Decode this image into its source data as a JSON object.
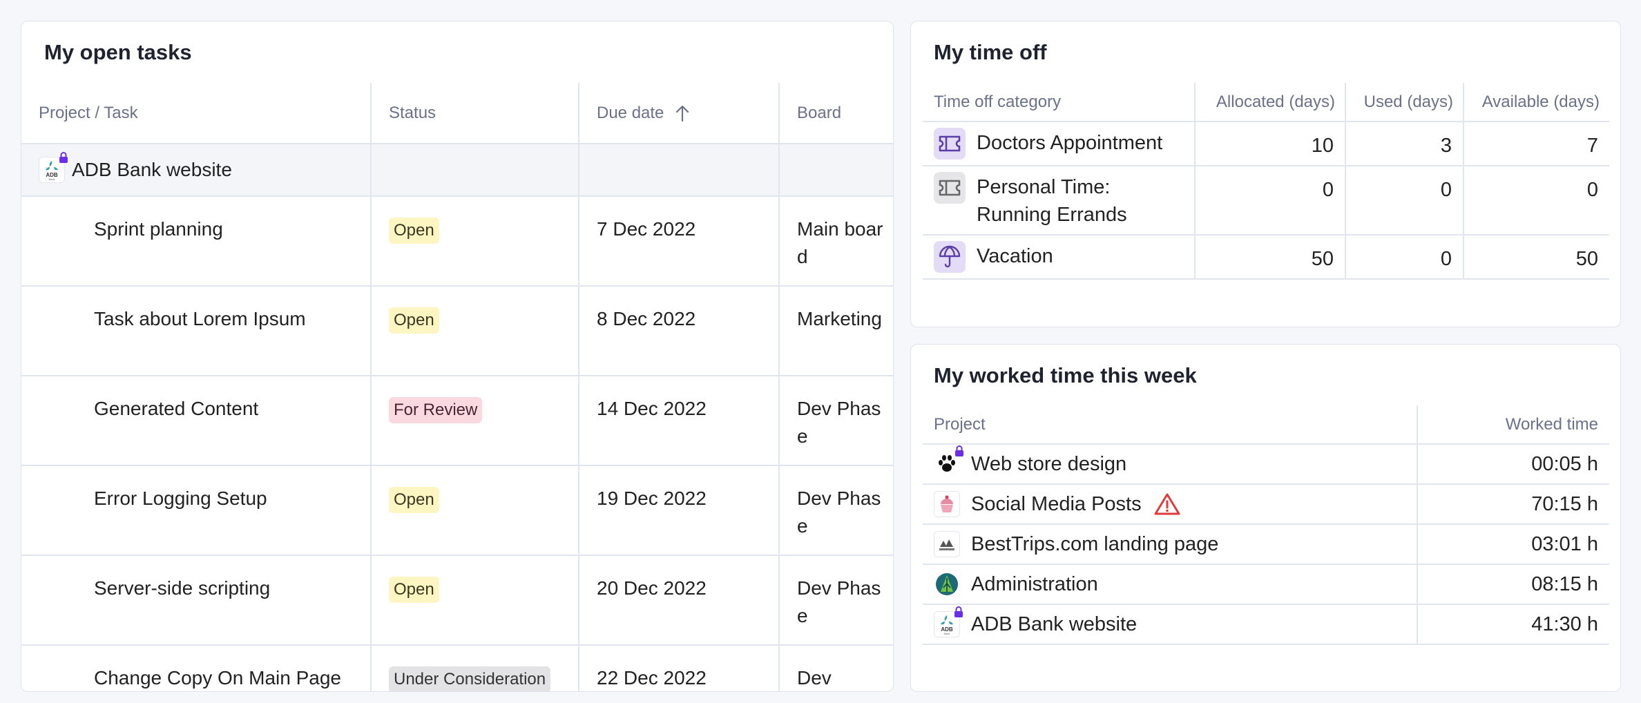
{
  "tasks": {
    "title": "My open tasks",
    "columns": {
      "project_task": "Project / Task",
      "status": "Status",
      "due_date": "Due date",
      "board": "Board"
    },
    "group": {
      "name": "ADB Bank website"
    },
    "rows": [
      {
        "name": "Sprint planning",
        "status": "Open",
        "due": "7 Dec 2022",
        "board": "Main board"
      },
      {
        "name": "Task about Lorem Ipsum",
        "status": "Open",
        "due": "8 Dec 2022",
        "board": "Marketing"
      },
      {
        "name": "Generated Content",
        "status": "For Review",
        "due": "14 Dec 2022",
        "board": "Dev Phase"
      },
      {
        "name": "Error Logging Setup",
        "status": "Open",
        "due": "19 Dec 2022",
        "board": "Dev Phase"
      },
      {
        "name": "Server-side scripting",
        "status": "Open",
        "due": "20 Dec 2022",
        "board": "Dev Phase"
      },
      {
        "name": "Change Copy On Main Page",
        "status": "Under Consideration",
        "due": "22 Dec 2022",
        "board": "Dev"
      }
    ]
  },
  "status_colors": {
    "Open": {
      "bg": "#fdf6c3",
      "fg": "#3b3620"
    },
    "For Review": {
      "bg": "#fbd9e1",
      "fg": "#4a2530"
    },
    "Under Consideration": {
      "bg": "#e3e3e5",
      "fg": "#333333"
    }
  },
  "time_off": {
    "title": "My time off",
    "columns": {
      "category": "Time off category",
      "allocated": "Allocated (days)",
      "used": "Used (days)",
      "available": "Available (days)"
    },
    "rows": [
      {
        "category": "Doctors Appointment",
        "icon": "ticket-icon",
        "icon_bg": "#e4dbf7",
        "icon_color": "#5b3ea8",
        "allocated": "10",
        "used": "3",
        "available": "7"
      },
      {
        "category": "Personal Time: Running Errands",
        "icon": "ticket-icon",
        "icon_bg": "#e6e6e8",
        "icon_color": "#666666",
        "allocated": "0",
        "used": "0",
        "available": "0"
      },
      {
        "category": "Vacation",
        "icon": "umbrella-icon",
        "icon_bg": "#e4dbf7",
        "icon_color": "#5b3ea8",
        "allocated": "50",
        "used": "0",
        "available": "50"
      }
    ]
  },
  "worked": {
    "title": "My worked time this week",
    "columns": {
      "project": "Project",
      "worked_time": "Worked time"
    },
    "rows": [
      {
        "project": "Web store design",
        "logo": "paw-logo",
        "locked": true,
        "warning": false,
        "time": "00:05 h"
      },
      {
        "project": "Social Media Posts",
        "logo": "cupcake-logo",
        "locked": false,
        "warning": true,
        "time": "70:15 h"
      },
      {
        "project": "BestTrips.com landing page",
        "logo": "besttrips-logo",
        "locked": false,
        "warning": false,
        "time": "03:01 h"
      },
      {
        "project": "Administration",
        "logo": "administration-logo",
        "locked": false,
        "warning": false,
        "time": "08:15 h"
      },
      {
        "project": "ADB Bank website",
        "logo": "adb-logo",
        "locked": true,
        "warning": false,
        "time": "41:30 h"
      }
    ]
  },
  "colors": {
    "lock": "#6a2ee8",
    "warning": "#e03a3a",
    "border": "#e1e5f0",
    "heading": "#1f2330",
    "muted": "#6a7189"
  }
}
